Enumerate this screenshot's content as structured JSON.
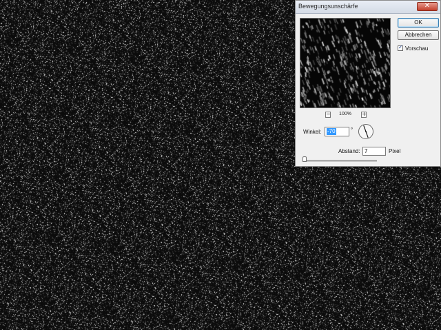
{
  "canvas": {
    "background": "#0b0b0b",
    "noise": "white speckle noise"
  },
  "dialog": {
    "title": "Bewegungsunschärfe",
    "close_glyph": "✕",
    "ok_label": "OK",
    "cancel_label": "Abbrechen",
    "preview_checkbox": {
      "label": "Vorschau",
      "checked": true,
      "glyph": "✓"
    },
    "zoom": {
      "out_glyph": "−",
      "in_glyph": "+",
      "level": "100%"
    },
    "angle": {
      "label": "Winkel:",
      "value": "-70",
      "unit": "°"
    },
    "distance": {
      "label": "Abstand:",
      "value": "7",
      "unit": "Pixel"
    },
    "slider": {
      "value_fraction": 0.0
    }
  },
  "colors": {
    "selection": "#3399ff",
    "dialog_bg": "#f0f0f0",
    "close_red": "#c4412d"
  }
}
